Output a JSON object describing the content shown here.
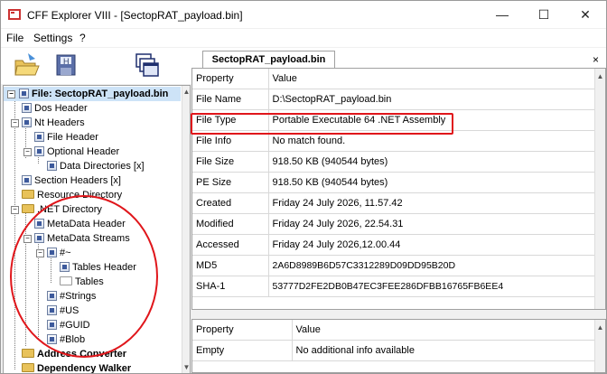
{
  "window": {
    "title": "CFF Explorer VIII - [SectopRAT_payload.bin]"
  },
  "window_buttons": {
    "minimize": "—",
    "maximize": "☐",
    "close": "✕"
  },
  "menu": [
    "File",
    "Settings",
    "?"
  ],
  "toolbar": {
    "icons": [
      "open-file-icon",
      "disk-save-icon",
      "windows-icon"
    ]
  },
  "tree": {
    "root": "File: SectopRAT_payload.bin",
    "items": [
      "Dos Header",
      "Nt Headers",
      "File Header",
      "Optional Header",
      "Data Directories [x]",
      "Section Headers [x]",
      "Resource Directory",
      ".NET Directory",
      "MetaData Header",
      "MetaData Streams",
      "#~",
      "Tables Header",
      "Tables",
      "#Strings",
      "#US",
      "#GUID",
      "#Blob",
      "Address Converter",
      "Dependency Walker"
    ]
  },
  "tab": {
    "label": "SectopRAT_payload.bin",
    "close": "×"
  },
  "properties": {
    "headers": [
      "Property",
      "Value"
    ],
    "rows": [
      [
        "File Name",
        "D:\\SectopRAT_payload.bin"
      ],
      [
        "File Type",
        "Portable Executable 64 .NET Assembly"
      ],
      [
        "File Info",
        "No match found."
      ],
      [
        "File Size",
        "918.50 KB (940544 bytes)"
      ],
      [
        "PE Size",
        "918.50 KB (940544 bytes)"
      ],
      [
        "Created",
        "Friday 24 July 2026, 11.57.42"
      ],
      [
        "Modified",
        "Friday 24 July 2026, 22.54.31"
      ],
      [
        "Accessed",
        "Friday 24 July 2026,12.00.44"
      ],
      [
        "MD5",
        "2A6D8989B6D57C3312289D09DD95B20D"
      ],
      [
        "SHA-1",
        "53777D2FE2DB0B47EC3FEE286DFBB16765FB6EE4"
      ]
    ]
  },
  "info": {
    "headers": [
      "Property",
      "Value"
    ],
    "rows": [
      [
        "Empty",
        "No additional info available"
      ]
    ]
  },
  "annotation_color": "#e0161b"
}
